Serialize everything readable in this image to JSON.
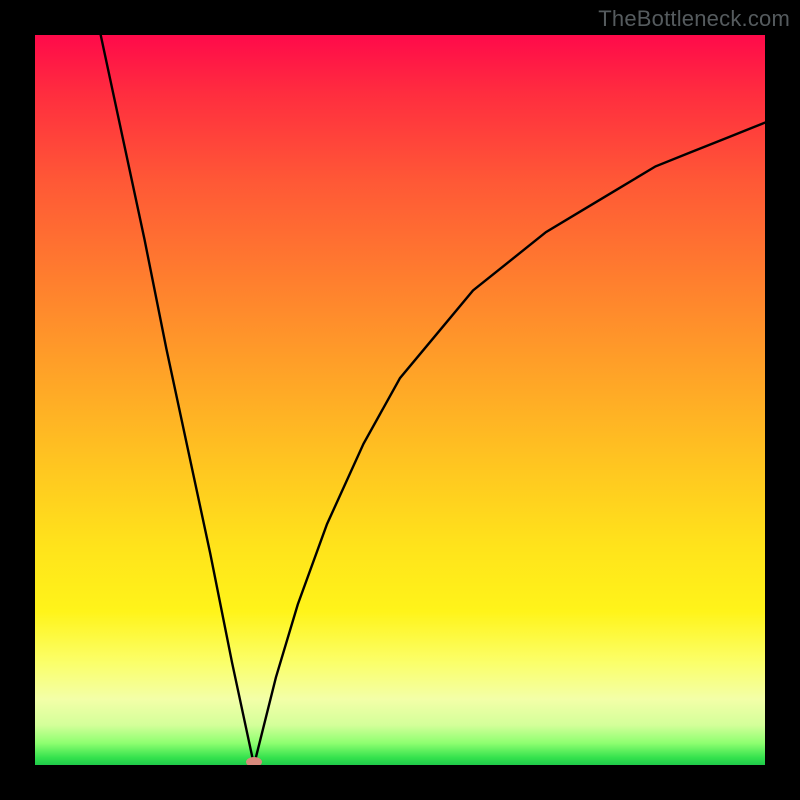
{
  "watermark": "TheBottleneck.com",
  "marker": {
    "color": "#d88a7d",
    "rx": 8,
    "ry": 5
  },
  "chart_data": {
    "type": "line",
    "title": "",
    "xlabel": "",
    "ylabel": "",
    "xlim": [
      0,
      100
    ],
    "ylim": [
      0,
      100
    ],
    "grid": false,
    "legend": false,
    "note": "Two branches meeting at a minimum near x≈30 (y≈0). Left branch descends from y=100 at x≈9 roughly linearly to the minimum. Right branch rises concavely from the minimum toward y≈88 at x=100. Values are estimated from the plot.",
    "series": [
      {
        "name": "left-branch",
        "x": [
          9,
          12,
          15,
          18,
          21,
          24,
          27,
          30
        ],
        "y": [
          100,
          86,
          72,
          57,
          43,
          29,
          14,
          0
        ]
      },
      {
        "name": "right-branch",
        "x": [
          30,
          33,
          36,
          40,
          45,
          50,
          55,
          60,
          65,
          70,
          75,
          80,
          85,
          90,
          95,
          100
        ],
        "y": [
          0,
          12,
          22,
          33,
          44,
          53,
          59,
          65,
          69,
          73,
          76,
          79,
          82,
          84,
          86,
          88
        ]
      }
    ],
    "minimum": {
      "x": 30,
      "y": 0
    }
  }
}
